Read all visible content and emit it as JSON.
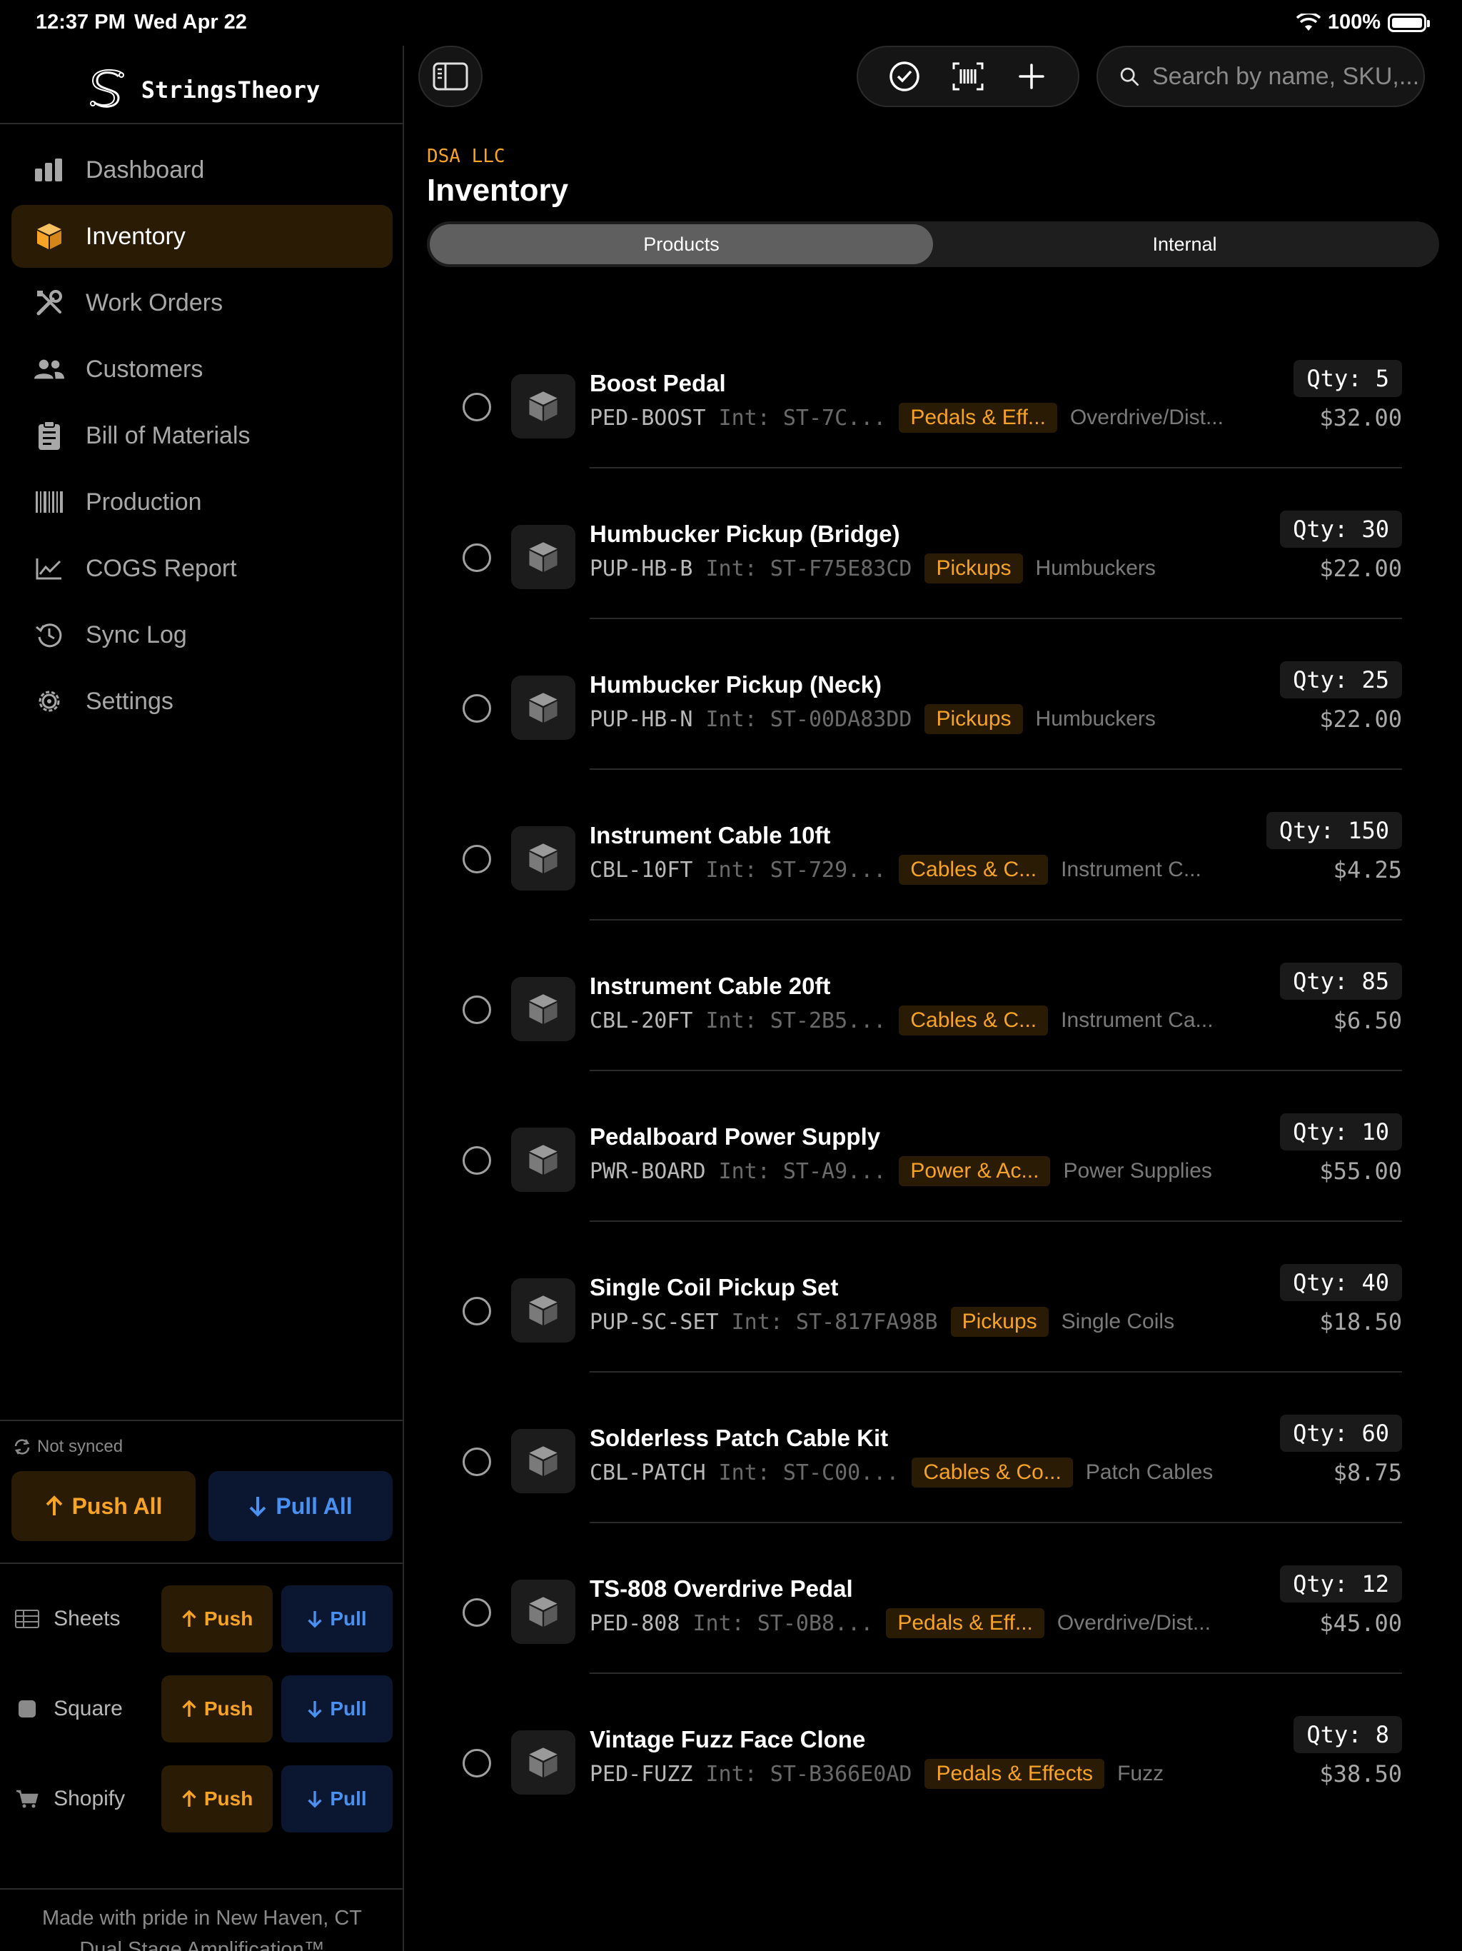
{
  "status_bar": {
    "time": "12:37 PM",
    "date": "Wed Apr 22",
    "battery": "100%"
  },
  "brand": {
    "name": "StringsTheory"
  },
  "sidebar": {
    "items": [
      {
        "label": "Dashboard",
        "icon": "chart-bar-icon",
        "active": false
      },
      {
        "label": "Inventory",
        "icon": "box-icon",
        "active": true
      },
      {
        "label": "Work Orders",
        "icon": "tools-icon",
        "active": false
      },
      {
        "label": "Customers",
        "icon": "people-icon",
        "active": false
      },
      {
        "label": "Bill of Materials",
        "icon": "clipboard-icon",
        "active": false
      },
      {
        "label": "Production",
        "icon": "barcode-icon",
        "active": false
      },
      {
        "label": "COGS Report",
        "icon": "line-chart-icon",
        "active": false
      },
      {
        "label": "Sync Log",
        "icon": "history-icon",
        "active": false
      },
      {
        "label": "Settings",
        "icon": "gear-icon",
        "active": false
      }
    ],
    "sync_status": "Not synced",
    "push_all": "Push All",
    "pull_all": "Pull All",
    "services": [
      {
        "name": "Sheets",
        "push": "Push",
        "pull": "Pull"
      },
      {
        "name": "Square",
        "push": "Push",
        "pull": "Pull"
      },
      {
        "name": "Shopify",
        "push": "Push",
        "pull": "Pull"
      }
    ],
    "footer": {
      "line1": "Made with pride in New Haven, CT",
      "line2": "Dual Stage Amplification™"
    }
  },
  "toolbar": {
    "search_placeholder": "Search by name, SKU,..."
  },
  "header": {
    "company": "DSA LLC",
    "title": "Inventory"
  },
  "tabs": [
    {
      "label": "Products",
      "active": true
    },
    {
      "label": "Internal",
      "active": false
    }
  ],
  "products": [
    {
      "name": "Boost Pedal",
      "sku": "PED-BOOST",
      "int": "Int: ST-7C...",
      "category": "Pedals & Eff...",
      "subcategory": "Overdrive/Dist...",
      "qty": "Qty: 5",
      "price": "$32.00"
    },
    {
      "name": "Humbucker Pickup (Bridge)",
      "sku": "PUP-HB-B",
      "int": "Int: ST-F75E83CD",
      "category": "Pickups",
      "subcategory": "Humbuckers",
      "qty": "Qty: 30",
      "price": "$22.00"
    },
    {
      "name": "Humbucker Pickup (Neck)",
      "sku": "PUP-HB-N",
      "int": "Int: ST-00DA83DD",
      "category": "Pickups",
      "subcategory": "Humbuckers",
      "qty": "Qty: 25",
      "price": "$22.00"
    },
    {
      "name": "Instrument Cable 10ft",
      "sku": "CBL-10FT",
      "int": "Int: ST-729...",
      "category": "Cables & C...",
      "subcategory": "Instrument C...",
      "qty": "Qty: 150",
      "price": "$4.25"
    },
    {
      "name": "Instrument Cable 20ft",
      "sku": "CBL-20FT",
      "int": "Int: ST-2B5...",
      "category": "Cables & C...",
      "subcategory": "Instrument Ca...",
      "qty": "Qty: 85",
      "price": "$6.50"
    },
    {
      "name": "Pedalboard Power Supply",
      "sku": "PWR-BOARD",
      "int": "Int: ST-A9...",
      "category": "Power & Ac...",
      "subcategory": "Power Supplies",
      "qty": "Qty: 10",
      "price": "$55.00"
    },
    {
      "name": "Single Coil Pickup Set",
      "sku": "PUP-SC-SET",
      "int": "Int: ST-817FA98B",
      "category": "Pickups",
      "subcategory": "Single Coils",
      "qty": "Qty: 40",
      "price": "$18.50"
    },
    {
      "name": "Solderless Patch Cable Kit",
      "sku": "CBL-PATCH",
      "int": "Int: ST-C00...",
      "category": "Cables & Co...",
      "subcategory": "Patch Cables",
      "qty": "Qty: 60",
      "price": "$8.75"
    },
    {
      "name": "TS-808 Overdrive Pedal",
      "sku": "PED-808",
      "int": "Int: ST-0B8...",
      "category": "Pedals & Eff...",
      "subcategory": "Overdrive/Dist...",
      "qty": "Qty: 12",
      "price": "$45.00"
    },
    {
      "name": "Vintage Fuzz Face Clone",
      "sku": "PED-FUZZ",
      "int": "Int: ST-B366E0AD",
      "category": "Pedals & Effects",
      "subcategory": "Fuzz",
      "qty": "Qty: 8",
      "price": "$38.50"
    }
  ],
  "colors": {
    "accent": "#f7a325",
    "pull_blue": "#4a90f0",
    "active_bg": "#2a1b04"
  }
}
